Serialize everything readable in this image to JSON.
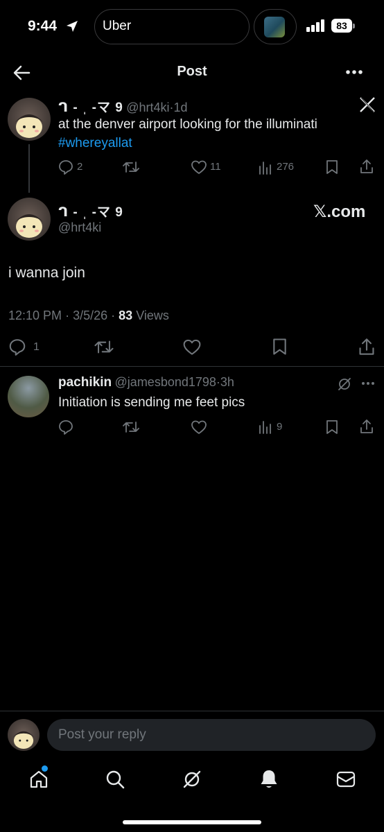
{
  "status_bar": {
    "time": "9:44",
    "island_app": "Uber",
    "battery": "83"
  },
  "header": {
    "title": "Post"
  },
  "parent_post": {
    "name": "ᒉ - ˌ -マ 9",
    "handle": "@hrt4ki",
    "dot": "·",
    "age": "1d",
    "text": "at the denver airport looking for the illuminati",
    "hashtag": "#whereyallat",
    "replies": "2",
    "likes": "11",
    "views": "276"
  },
  "main_post": {
    "name": "ᒉ - ˌ -マ 9",
    "handle": "@hrt4ki",
    "watermark": "𝕏.com",
    "text": "i wanna join",
    "time": "12:10 PM",
    "sep": "·",
    "date": "3/5/26",
    "views_count": "83",
    "views_label": "Views",
    "replies": "1"
  },
  "reply_post": {
    "name": "pachikin",
    "handle": "@jamesbond1798",
    "dot": "·",
    "age": "3h",
    "text": "Initiation is sending me feet pics",
    "views": "9"
  },
  "composer": {
    "placeholder": "Post your reply"
  },
  "colors": {
    "accent": "#1d9bf0",
    "background": "#000000",
    "muted": "#71767b"
  },
  "icons": [
    "back-arrow-icon",
    "more-icon",
    "x-logo-icon",
    "reply-icon",
    "repost-icon",
    "like-icon",
    "views-icon",
    "bookmark-icon",
    "share-icon",
    "grok-icon",
    "home-icon",
    "search-icon",
    "notifications-icon",
    "messages-icon"
  ]
}
